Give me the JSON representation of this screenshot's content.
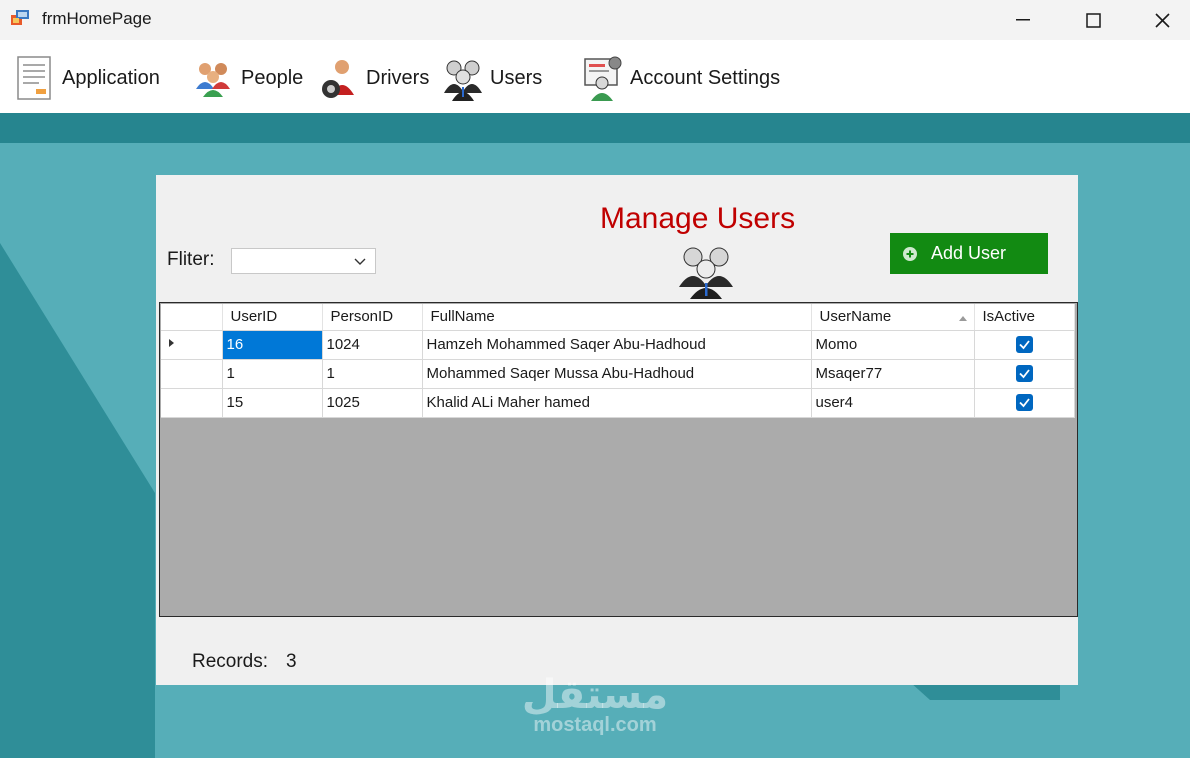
{
  "window": {
    "title": "frmHomePage"
  },
  "menu": {
    "items": [
      {
        "label": "Application",
        "icon": "application-icon"
      },
      {
        "label": "People",
        "icon": "people-icon"
      },
      {
        "label": "Drivers",
        "icon": "drivers-icon"
      },
      {
        "label": "Users",
        "icon": "users-icon"
      },
      {
        "label": "Account Settings",
        "icon": "account-settings-icon"
      }
    ]
  },
  "panel": {
    "title": "Manage Users",
    "filter_label": "Fliter:",
    "filter_value": "",
    "add_button_label": "Add User",
    "records_label": "Records:",
    "records_count": "3"
  },
  "grid": {
    "columns": [
      "UserID",
      "PersonID",
      "FullName",
      "UserName",
      "IsActive"
    ],
    "sorted_column": "UserName",
    "rows": [
      {
        "user_id": "16",
        "person_id": "1024",
        "full_name": "Hamzeh Mohammed Saqer Abu-Hadhoud",
        "user_name": "Momo",
        "is_active": true
      },
      {
        "user_id": "1",
        "person_id": "1",
        "full_name": "Mohammed Saqer Mussa Abu-Hadhoud",
        "user_name": "Msaqer77",
        "is_active": true
      },
      {
        "user_id": "15",
        "person_id": "1025",
        "full_name": "Khalid ALi Maher hamed",
        "user_name": "user4",
        "is_active": true
      }
    ]
  },
  "watermark": {
    "arabic": "مستقل",
    "latin": "mostaql.com"
  },
  "colors": {
    "accent_teal": "#56aeb8",
    "title_red": "#c00000",
    "button_green": "#128a12",
    "selection_blue": "#0078d7"
  }
}
